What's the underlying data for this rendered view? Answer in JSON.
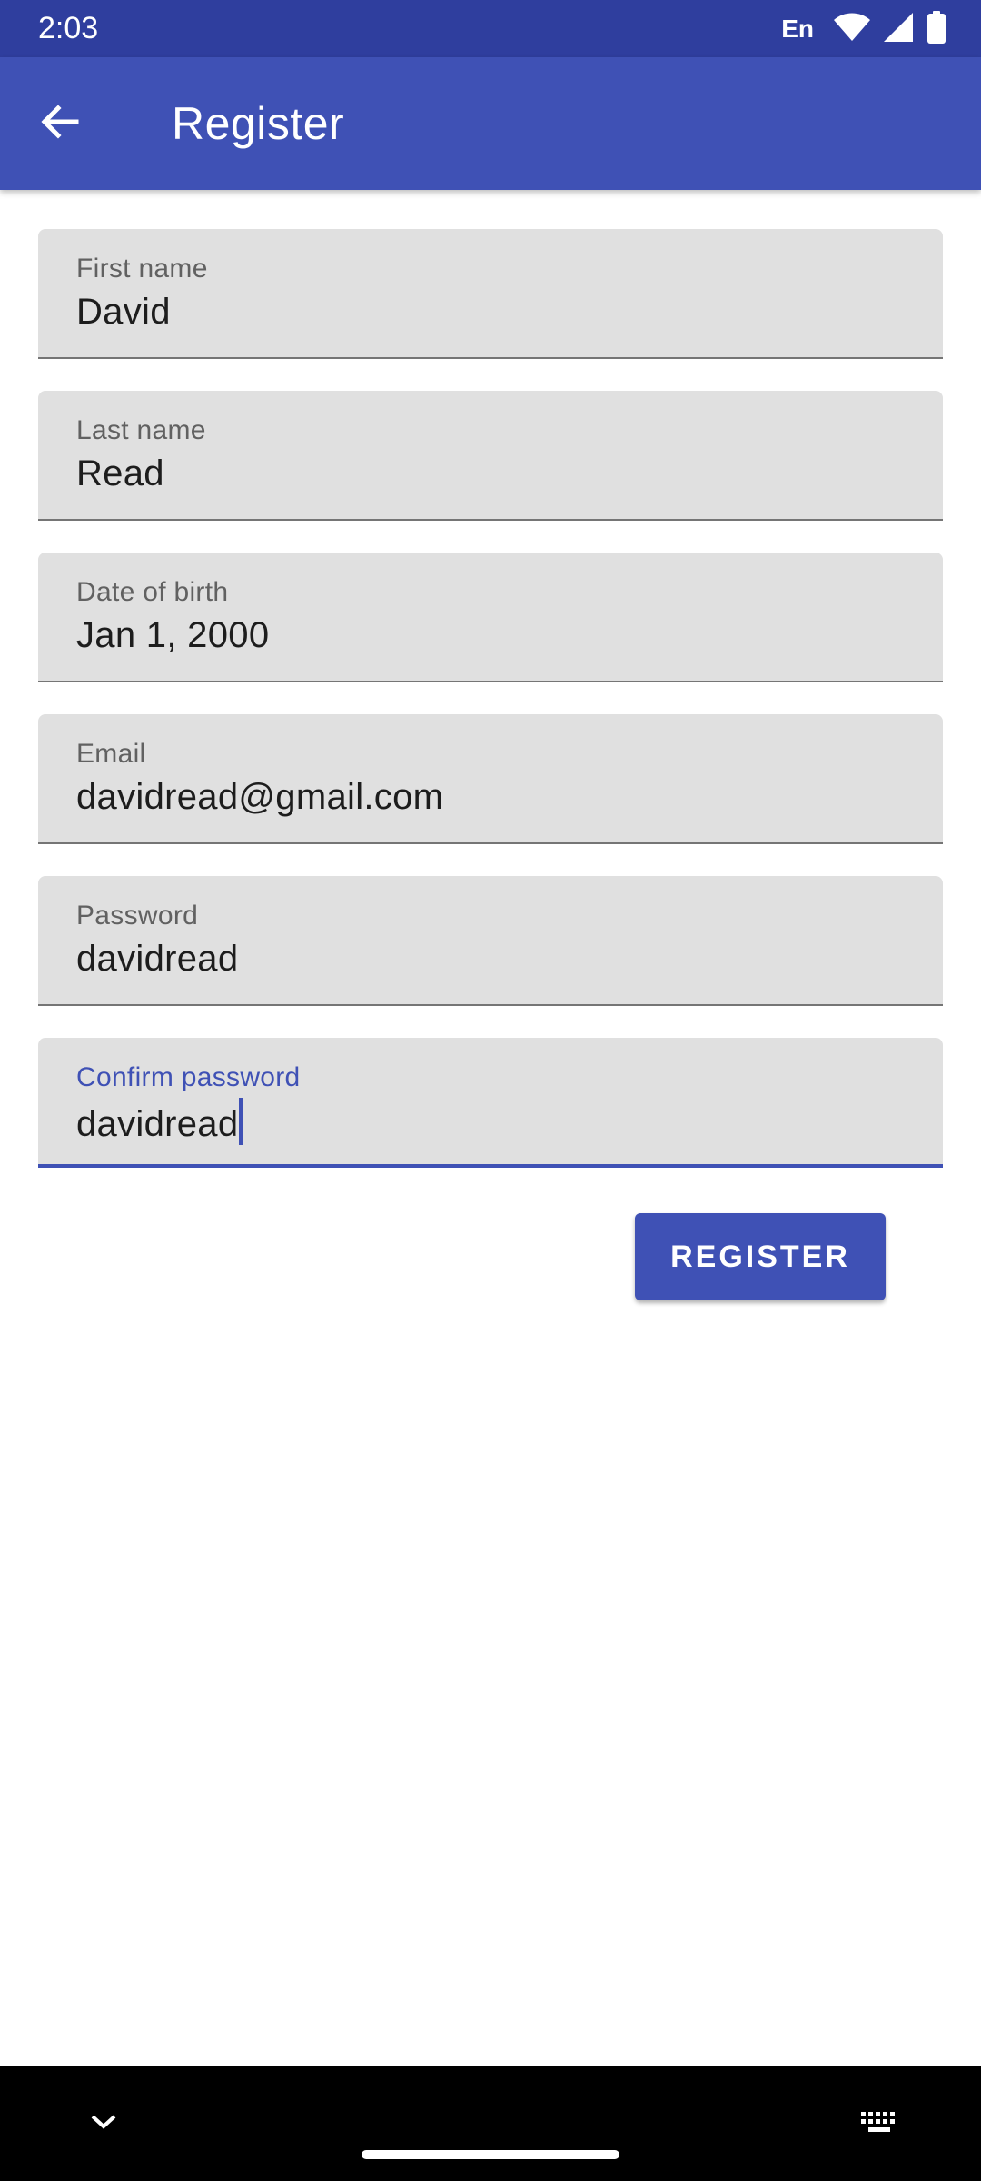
{
  "status_bar": {
    "time": "2:03",
    "language": "En",
    "icons": [
      "wifi-icon",
      "signal-icon",
      "battery-icon"
    ]
  },
  "app_bar": {
    "title": "Register",
    "back_icon": "arrow-back-icon"
  },
  "form": {
    "fields": [
      {
        "label": "First name",
        "value": "David"
      },
      {
        "label": "Last name",
        "value": "Read"
      },
      {
        "label": "Date of birth",
        "value": "Jan 1, 2000"
      },
      {
        "label": "Email",
        "value": "davidread@gmail.com"
      },
      {
        "label": "Password",
        "value": "davidread"
      },
      {
        "label": "Confirm password",
        "value": "davidread",
        "focused": true
      }
    ],
    "register_label": "REGISTER"
  },
  "nav_bar": {
    "icons": [
      "chevron-down-icon",
      "home-handle",
      "keyboard-icon"
    ]
  },
  "colors": {
    "primary": "#3f51b5",
    "primary_dark": "#2f3e9e",
    "field_background": "#e0e0e0"
  }
}
